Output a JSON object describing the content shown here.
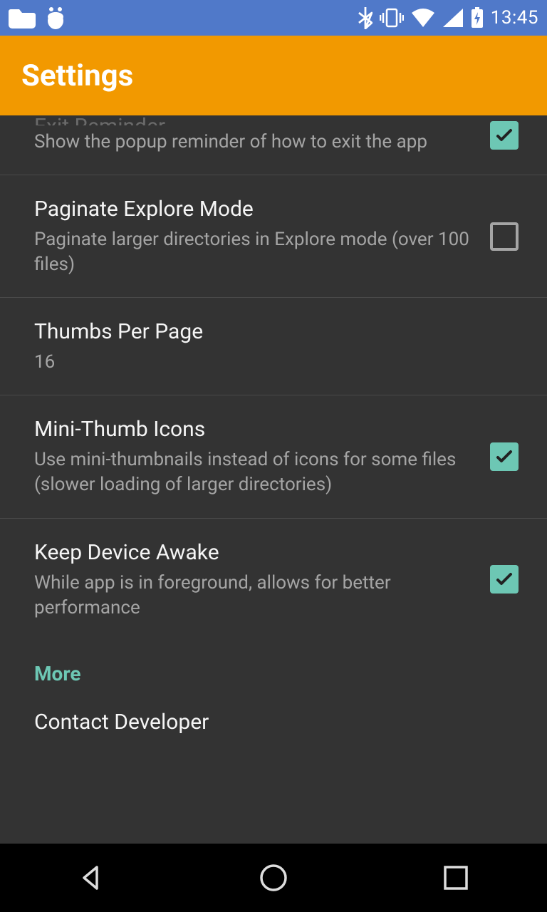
{
  "status": {
    "time": "13:45"
  },
  "header": {
    "title": "Settings"
  },
  "items": {
    "exit_reminder": {
      "title": "Exit Reminder",
      "sub": "Show the popup reminder of how to exit the app",
      "checked": true
    },
    "paginate": {
      "title": "Paginate Explore Mode",
      "sub": "Paginate larger directories in Explore mode (over 100 files)",
      "checked": false
    },
    "thumbs_per_page": {
      "title": "Thumbs Per Page",
      "sub": "16"
    },
    "mini_thumb": {
      "title": "Mini-Thumb Icons",
      "sub": "Use mini-thumbnails instead of icons for some files (slower loading of larger directories)",
      "checked": true
    },
    "keep_awake": {
      "title": "Keep Device Awake",
      "sub": "While app is in foreground, allows for better performance",
      "checked": true
    }
  },
  "section": {
    "more": "More"
  },
  "contact": {
    "title": "Contact Developer"
  }
}
